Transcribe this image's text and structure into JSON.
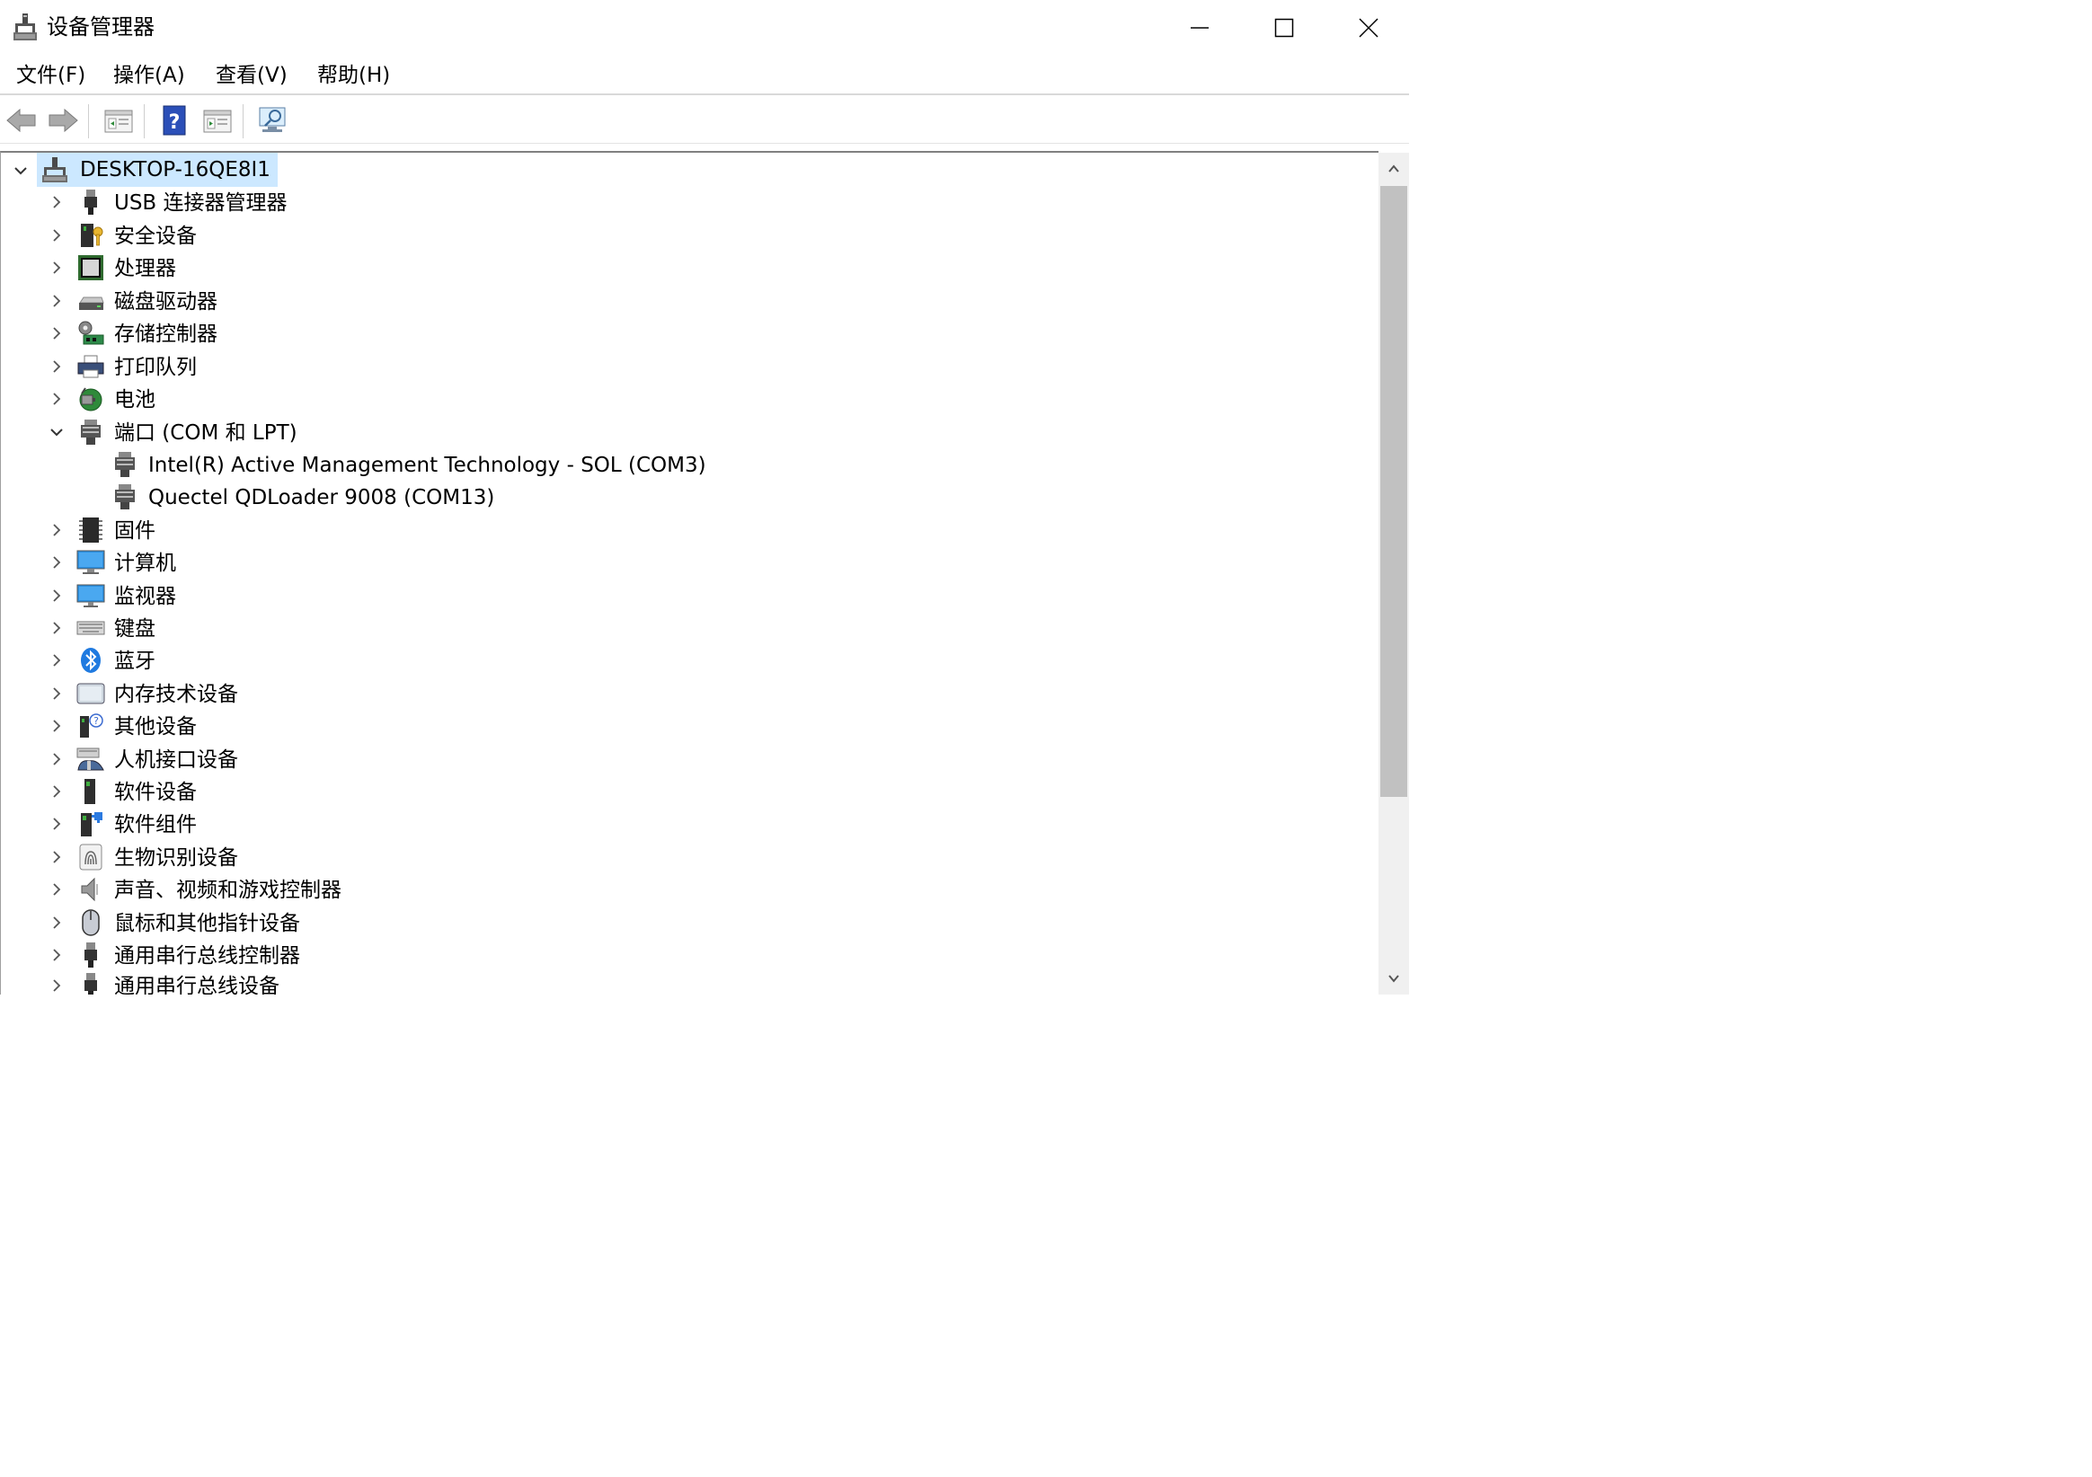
{
  "window": {
    "title": "设备管理器",
    "buttons": {
      "minimize": "minimize",
      "maximize": "maximize",
      "close": "close"
    }
  },
  "menu": {
    "items": [
      "文件(F)",
      "操作(A)",
      "查看(V)",
      "帮助(H)"
    ]
  },
  "toolbar": {
    "buttons": [
      "back-arrow-icon",
      "forward-arrow-icon",
      "properties-pane-icon",
      "help-icon",
      "action-pane-icon",
      "scan-hardware-icon"
    ]
  },
  "tree": {
    "root": {
      "label": "DESKTOP-16QE8I1",
      "expanded": true,
      "icon": "computer-network-icon"
    },
    "categories": [
      {
        "label": "USB 连接器管理器",
        "icon": "usb-plug-icon",
        "expanded": false
      },
      {
        "label": "安全设备",
        "icon": "security-key-icon",
        "expanded": false
      },
      {
        "label": "处理器",
        "icon": "processor-icon",
        "expanded": false
      },
      {
        "label": "磁盘驱动器",
        "icon": "disk-drive-icon",
        "expanded": false
      },
      {
        "label": "存储控制器",
        "icon": "storage-controller-icon",
        "expanded": false
      },
      {
        "label": "打印队列",
        "icon": "printer-icon",
        "expanded": false
      },
      {
        "label": "电池",
        "icon": "battery-icon",
        "expanded": false
      },
      {
        "label": "端口 (COM 和 LPT)",
        "icon": "port-connector-icon",
        "expanded": true
      },
      {
        "label": "Intel(R) Active Management Technology - SOL (COM3)",
        "icon": "port-connector-icon",
        "child": true
      },
      {
        "label": "Quectel QDLoader 9008 (COM13)",
        "icon": "port-connector-icon",
        "child": true
      },
      {
        "label": "固件",
        "icon": "firmware-chip-icon",
        "expanded": false
      },
      {
        "label": "计算机",
        "icon": "computer-monitor-icon",
        "expanded": false
      },
      {
        "label": "监视器",
        "icon": "monitor-icon",
        "expanded": false
      },
      {
        "label": "键盘",
        "icon": "keyboard-icon",
        "expanded": false
      },
      {
        "label": "蓝牙",
        "icon": "bluetooth-icon",
        "expanded": false
      },
      {
        "label": "内存技术设备",
        "icon": "memory-device-icon",
        "expanded": false
      },
      {
        "label": "其他设备",
        "icon": "unknown-device-icon",
        "expanded": false
      },
      {
        "label": "人机接口设备",
        "icon": "hid-icon",
        "expanded": false
      },
      {
        "label": "软件设备",
        "icon": "software-device-icon",
        "expanded": false
      },
      {
        "label": "软件组件",
        "icon": "software-component-icon",
        "expanded": false
      },
      {
        "label": "生物识别设备",
        "icon": "fingerprint-icon",
        "expanded": false
      },
      {
        "label": "声音、视频和游戏控制器",
        "icon": "speaker-icon",
        "expanded": false
      },
      {
        "label": "鼠标和其他指针设备",
        "icon": "mouse-icon",
        "expanded": false
      },
      {
        "label": "通用串行总线控制器",
        "icon": "usb-plug-icon",
        "expanded": false
      },
      {
        "label": "通用串行总线设备",
        "icon": "usb-plug-icon",
        "expanded": false
      }
    ]
  },
  "colors": {
    "selection": "#cce8ff",
    "scroll_thumb": "#c1c1c1",
    "scroll_track": "#f0f0f0",
    "monitor_blue": "#2b8fe0",
    "bluetooth_blue": "#1f7ae0"
  }
}
